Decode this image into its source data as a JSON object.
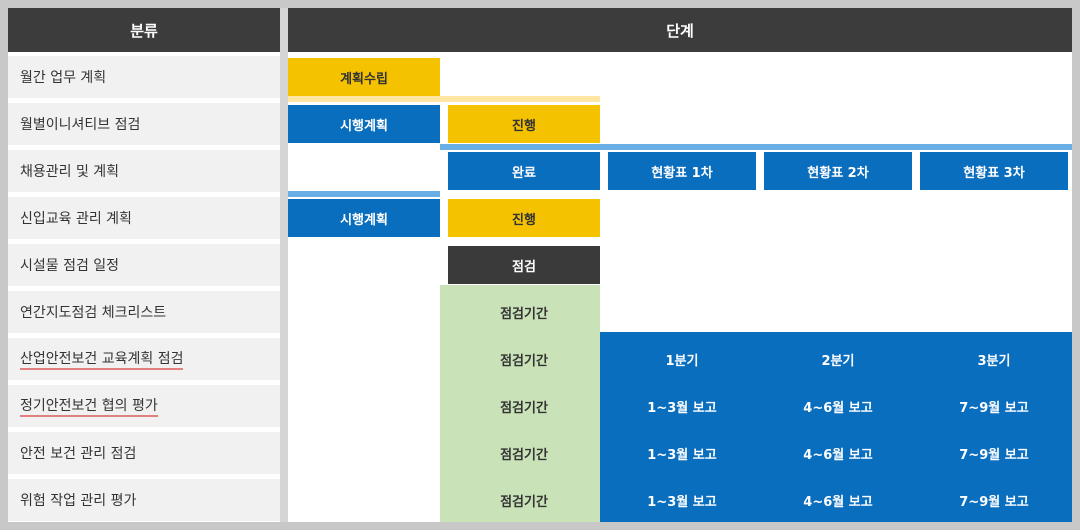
{
  "header": {
    "left": "분류",
    "right": "단계"
  },
  "rows": [
    {
      "label": "월간 업무 계획"
    },
    {
      "label": "월별이니셔티브 점검"
    },
    {
      "label": "채용관리 및 계획"
    },
    {
      "label": "신입교육 관리 계획"
    },
    {
      "label": "시설물 점검 일정"
    },
    {
      "label": "연간지도점검 체크리스트"
    },
    {
      "label": "산업안전보건 교육계획 점검"
    },
    {
      "label": "정기안전보건 협의 평가"
    },
    {
      "label": "안전 보건 관리 점검"
    },
    {
      "label": "위험 작업 관리 평가"
    }
  ],
  "cells": {
    "r1c1": "계획수립",
    "r2c1": "시행계획",
    "r2c2": "진행",
    "r3c2": "완료",
    "r3c3": "현황표 1차",
    "r3c4": "현황표 2차",
    "r3c5": "현황표 3차",
    "r4c1": "시행계획",
    "r4c2": "진행",
    "r5c2": "점검",
    "r6c2": "점검기간",
    "r7c2": "점검기간",
    "r7c3": "1분기",
    "r7c4": "2분기",
    "r7c5": "3분기",
    "r8c2": "점검기간",
    "r8c3": "1~3월 보고",
    "r8c4": "4~6월 보고",
    "r8c5": "7~9월 보고",
    "r9c2": "점검기간",
    "r9c3": "1~3월 보고",
    "r9c4": "4~6월 보고",
    "r9c5": "7~9월 보고",
    "r10c2": "점검기간",
    "r10c3": "1~3월 보고",
    "r10c4": "4~6월 보고",
    "r10c5": "7~9월 보고"
  }
}
